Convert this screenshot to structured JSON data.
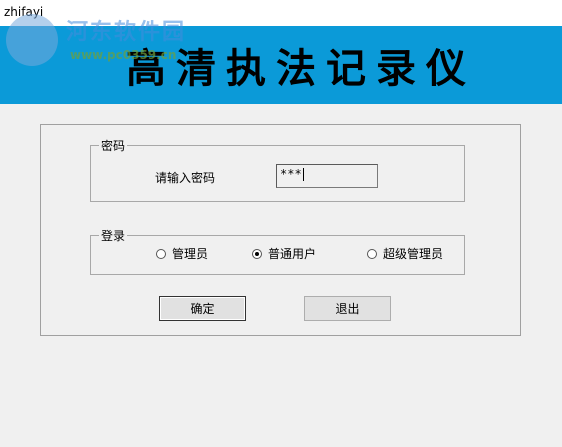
{
  "window": {
    "title": "zhifayi"
  },
  "watermark": {
    "text": "河东软件园",
    "url": "www.pc0359.cn"
  },
  "banner": {
    "title": "高清执法记录仪",
    "background": "#0b9ad8"
  },
  "password_group": {
    "legend": "密码",
    "prompt": "请输入密码",
    "value": "***"
  },
  "login_group": {
    "legend": "登录",
    "options": [
      {
        "label": "管理员",
        "checked": false
      },
      {
        "label": "普通用户",
        "checked": true
      },
      {
        "label": "超级管理员",
        "checked": false
      }
    ]
  },
  "buttons": {
    "ok": "确定",
    "exit": "退出"
  }
}
